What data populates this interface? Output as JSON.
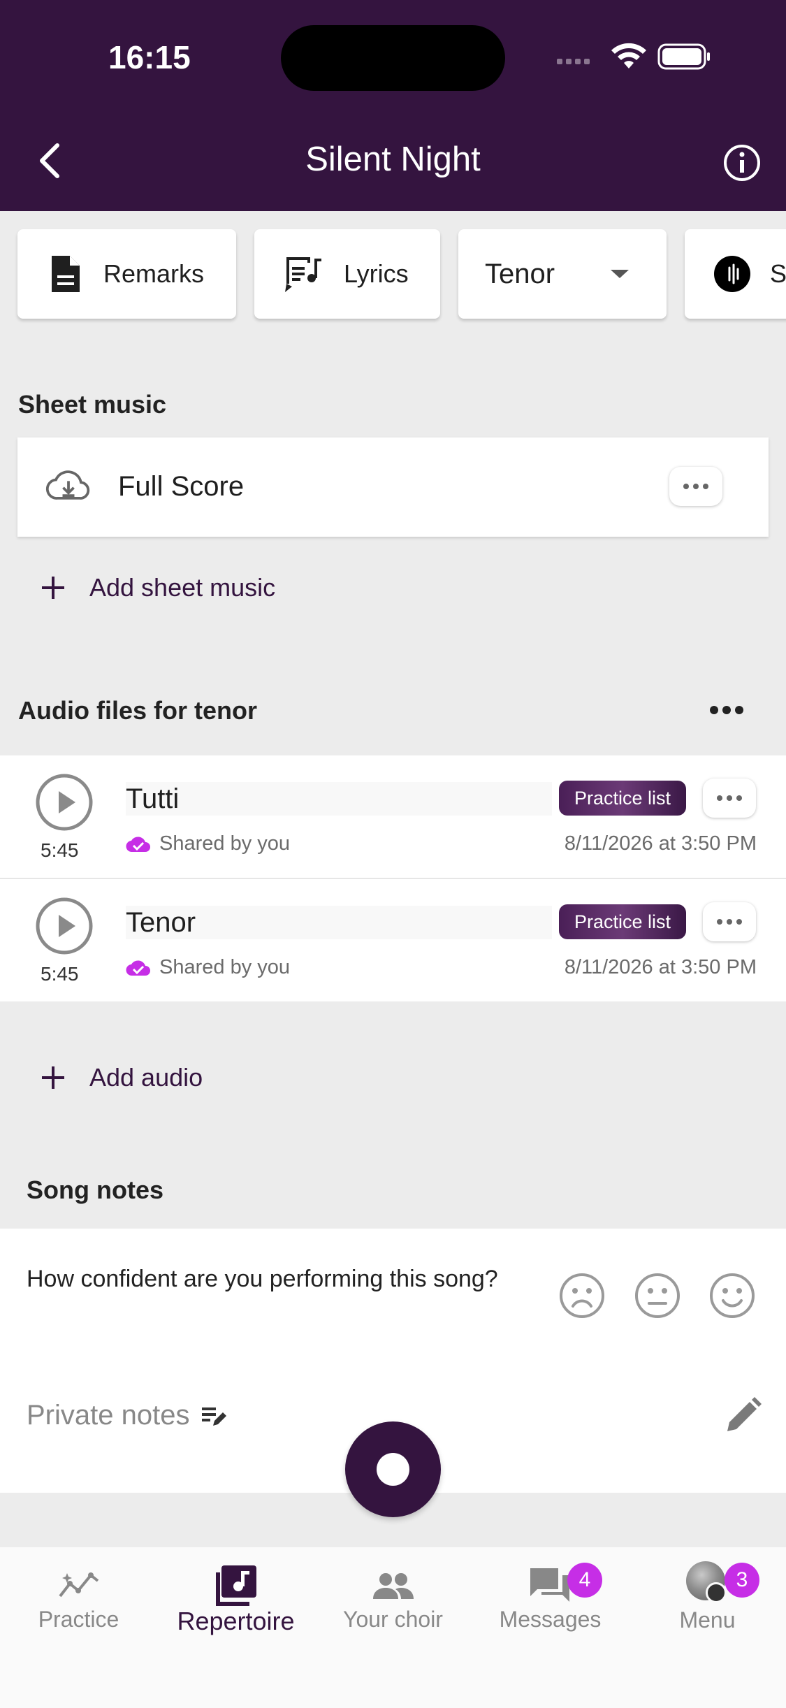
{
  "status_bar": {
    "time": "16:15"
  },
  "header": {
    "title": "Silent Night"
  },
  "chips": {
    "remarks": "Remarks",
    "lyrics": "Lyrics",
    "voice_part": "Tenor",
    "partial": "S"
  },
  "sheet_music": {
    "section_title": "Sheet music",
    "items": [
      {
        "name": "Full Score"
      }
    ],
    "add_label": "Add sheet music"
  },
  "audio": {
    "section_title": "Audio files for tenor",
    "items": [
      {
        "name": "Tutti",
        "duration": "5:45",
        "badge": "Practice list",
        "shared": "Shared by you",
        "date": "8/11/2026 at 3:50 PM"
      },
      {
        "name": "Tenor",
        "duration": "5:45",
        "badge": "Practice list",
        "shared": "Shared by you",
        "date": "8/11/2026 at 3:50 PM"
      }
    ],
    "add_label": "Add audio"
  },
  "song_notes": {
    "section_title": "Song notes",
    "question": "How confident are you performing this song?",
    "private_notes_label": "Private notes"
  },
  "bottom_nav": {
    "items": [
      {
        "label": "Practice",
        "icon": "chart-icon"
      },
      {
        "label": "Repertoire",
        "icon": "music-note-icon",
        "active": true
      },
      {
        "label": "Your choir",
        "icon": "people-icon"
      },
      {
        "label": "Messages",
        "icon": "chat-icon",
        "badge": "4"
      },
      {
        "label": "Menu",
        "icon": "avatar",
        "badge": "3"
      }
    ]
  },
  "colors": {
    "brand": "#34143f",
    "badge": "#c62ee6",
    "shared_icon": "#c62ee6"
  }
}
